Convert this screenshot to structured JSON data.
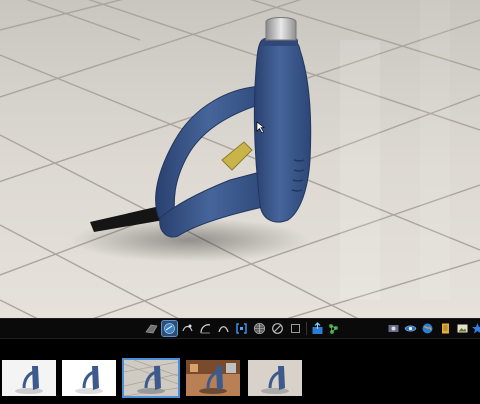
{
  "viewer": {
    "scene": "heat-gun-on-tile-floor",
    "colors": {
      "body": "#3c5a8c",
      "trigger": "#c9b44a",
      "nozzle": "#c8c8c8",
      "cord": "#111111",
      "floor": "#d8d4ce",
      "grout": "#b8b2a8"
    }
  },
  "toolbar": {
    "tools": [
      {
        "icon": "floor-plane-icon",
        "active": false
      },
      {
        "icon": "texture-icon",
        "active": true
      },
      {
        "icon": "material-icon",
        "active": false
      },
      {
        "icon": "curve-icon",
        "active": false
      },
      {
        "icon": "arc-icon",
        "active": false
      },
      {
        "icon": "bracket-frame-icon",
        "active": false
      },
      {
        "icon": "grid-icon",
        "active": false
      },
      {
        "icon": "circle-slash-icon",
        "active": false
      },
      {
        "icon": "box-icon",
        "active": false
      },
      {
        "icon": "export-icon",
        "active": false
      },
      {
        "icon": "molecule-icon",
        "active": false
      },
      {
        "icon": "scene-settings-icon",
        "active": false
      },
      {
        "icon": "eye-icon",
        "active": false
      },
      {
        "icon": "globe-icon",
        "active": false
      },
      {
        "icon": "document-icon",
        "active": false
      },
      {
        "icon": "gallery-icon",
        "active": false
      },
      {
        "icon": "star-icon",
        "active": false
      }
    ]
  },
  "thumbnails": [
    {
      "name": "white-background",
      "selected": false
    },
    {
      "name": "white-studio",
      "selected": false
    },
    {
      "name": "tile-floor",
      "selected": true
    },
    {
      "name": "workshop",
      "selected": false
    },
    {
      "name": "gray-studio",
      "selected": false
    }
  ]
}
